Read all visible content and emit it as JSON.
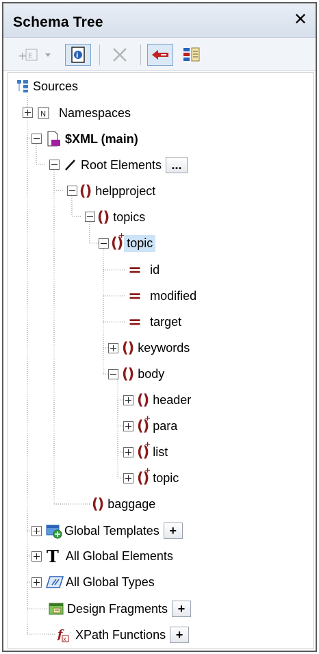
{
  "panel": {
    "title": "Schema Tree",
    "close_glyph": "✕"
  },
  "toolbar": {
    "buttons": [
      {
        "name": "add-item-dropdown",
        "icon": "add-item-icon",
        "enabled": false
      },
      {
        "name": "show-details",
        "icon": "details-icon",
        "pressed": true
      },
      {
        "name": "remove",
        "icon": "delete-icon",
        "enabled": false
      },
      {
        "name": "sync-tree",
        "icon": "sync-icon",
        "pressed": true
      },
      {
        "name": "sort-tree",
        "icon": "sort-icon"
      }
    ]
  },
  "tree": {
    "sources": "Sources",
    "namespaces": "Namespaces",
    "xml_main": "$XML (main)",
    "root_elements": "Root Elements",
    "ellipsis": "...",
    "helpproject": "helpproject",
    "topics": "topics",
    "topic": "topic",
    "attr_id": "id",
    "attr_modified": "modified",
    "attr_target": "target",
    "keywords": "keywords",
    "body": "body",
    "header": "header",
    "para": "para",
    "list": "list",
    "topic_child": "topic",
    "baggage": "baggage",
    "global_templates": "Global Templates",
    "all_global_elements": "All Global Elements",
    "all_global_types": "All Global Types",
    "design_fragments": "Design Fragments",
    "xpath_functions": "XPath Functions",
    "plus": "+"
  },
  "colors": {
    "element": "#8b1a1a",
    "selection": "#cde3f7",
    "accent": "#3c7bc8"
  }
}
